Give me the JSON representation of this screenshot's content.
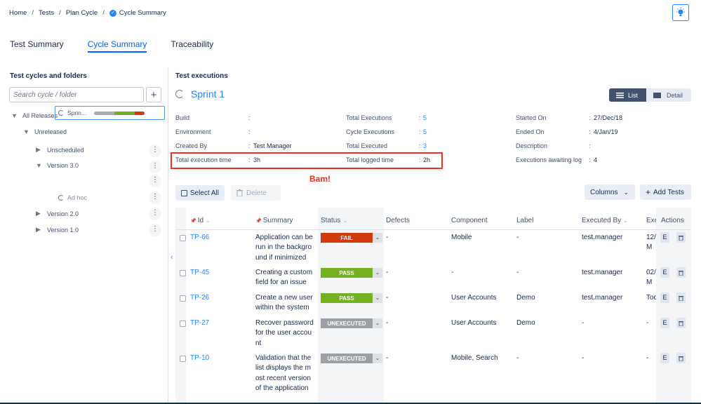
{
  "breadcrumb": {
    "items": [
      "Home",
      "Tests",
      "Plan Cycle",
      "Cycle Summary"
    ],
    "separator": "/"
  },
  "tabs": [
    {
      "label": "Test Summary",
      "active": false
    },
    {
      "label": "Cycle Summary",
      "active": true
    },
    {
      "label": "Traceability",
      "active": false
    }
  ],
  "left_panel": {
    "title": "Test cycles and folders",
    "search_placeholder": "Search cycle / folder",
    "tree": {
      "all_releases": "All Releases",
      "unreleased": "Unreleased",
      "unscheduled": "Unscheduled",
      "version_3": "Version 3.0",
      "sprint_label": "Sprin...",
      "adhoc_label": "Ad hoc",
      "version_2": "Version 2.0",
      "version_1": "Version 1.0"
    },
    "sprint_progress": {
      "not_executed": 0.4,
      "pass": 0.4,
      "fail": 0.2
    }
  },
  "right_panel": {
    "title": "Test executions",
    "cycle_name": "Sprint 1",
    "view_toggle": {
      "list": "List",
      "detail": "Detail",
      "selected": "List"
    },
    "info": {
      "build": {
        "label": "Build",
        "value": ""
      },
      "environment": {
        "label": "Environment",
        "value": ""
      },
      "created_by": {
        "label": "Created By",
        "value": "Test Manager"
      },
      "total_execution_time": {
        "label": "Total execution time",
        "value": "3h"
      },
      "total_executions": {
        "label": "Total Executions",
        "value": "5"
      },
      "cycle_executions": {
        "label": "Cycle Executions",
        "value": "5"
      },
      "total_executed": {
        "label": "Total Executed",
        "value": "3"
      },
      "total_logged_time": {
        "label": "Total logged time",
        "value": "2h"
      },
      "started_on": {
        "label": "Started On",
        "value": "27/Dec/18"
      },
      "ended_on": {
        "label": "Ended On",
        "value": "4/Jan/19"
      },
      "description": {
        "label": "Description",
        "value": ""
      },
      "awaiting_log": {
        "label": "Executions awaiting log",
        "value": "4"
      }
    },
    "annotation": "Bam!",
    "buttons": {
      "select_all": "Select All",
      "delete": "Delete",
      "columns": "Columns",
      "add_tests": "Add Tests"
    }
  },
  "table": {
    "headers": [
      "Id",
      "Summary",
      "Status",
      "Defects",
      "Component",
      "Label",
      "Executed By",
      "Exe",
      "Actions"
    ],
    "rows": [
      {
        "id": "TP-66",
        "summary": [
          "Application can be",
          "run in the backgro",
          "und if minimized"
        ],
        "status": "FAIL",
        "defects": "-",
        "component": "Mobile",
        "label": "-",
        "executed_by": "test.manager",
        "exe": [
          "12/",
          "M"
        ]
      },
      {
        "id": "TP-45",
        "summary": [
          "Creating a custom",
          "field for an issue"
        ],
        "status": "PASS",
        "defects": "-",
        "component": "-",
        "label": "-",
        "executed_by": "test.manager",
        "exe": [
          "02/",
          "M"
        ]
      },
      {
        "id": "TP-26",
        "summary": [
          "Create a new user",
          "within the system"
        ],
        "status": "PASS",
        "defects": "-",
        "component": "User Accounts",
        "label": "Demo",
        "executed_by": "test.manager",
        "exe": [
          "Toc"
        ]
      },
      {
        "id": "TP-27",
        "summary": [
          "Recover password",
          "for the user accou",
          "nt"
        ],
        "status": "UNEXECUTED",
        "defects": "-",
        "component": "User Accounts",
        "label": "Demo",
        "executed_by": "-",
        "exe": [
          "-"
        ]
      },
      {
        "id": "TP-10",
        "summary": [
          "Validation that the",
          "list displays the m",
          "ost recent version",
          "of the application"
        ],
        "status": "UNEXECUTED",
        "defects": "-",
        "component": "Mobile, Search",
        "label": "-",
        "executed_by": "-",
        "exe": [
          "-"
        ]
      }
    ],
    "action_edit": "E"
  },
  "colors": {
    "accent": "#2684ff",
    "fail": "#d13b0c",
    "pass": "#74b120",
    "unexecuted": "#9aa0a6",
    "annotation": "#f0321e"
  }
}
